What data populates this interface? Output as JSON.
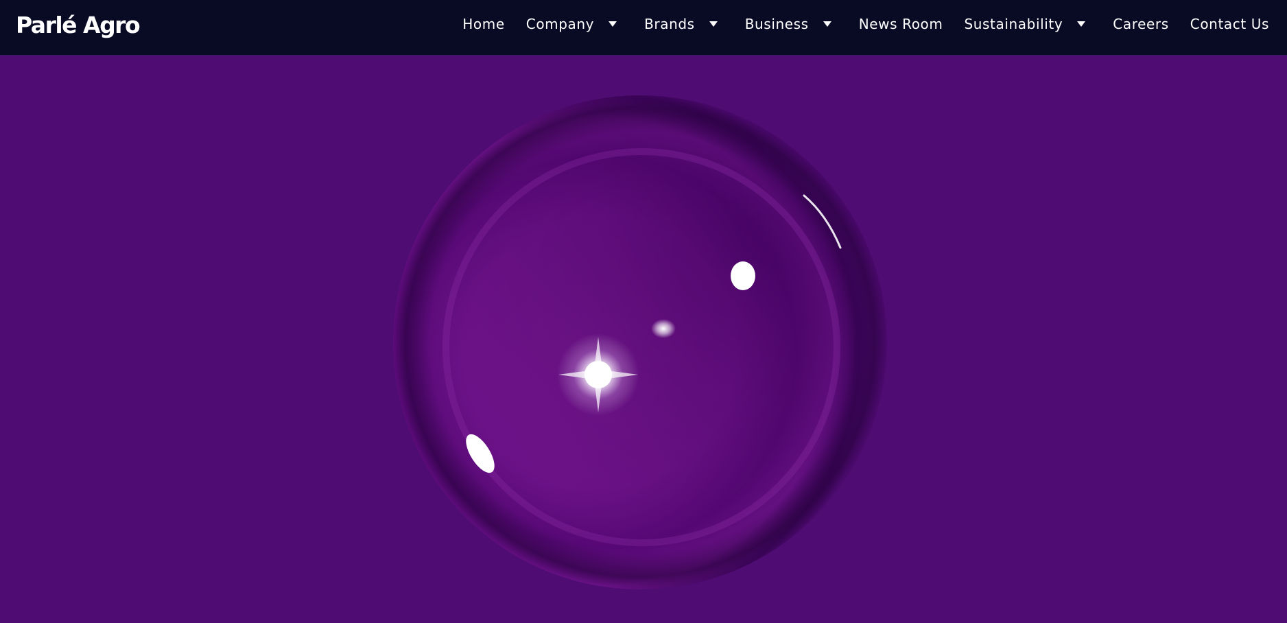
{
  "brand": {
    "logo_text": "Parlé Agro"
  },
  "nav": {
    "items": [
      {
        "label": "Home",
        "has_dropdown": false
      },
      {
        "label": "Company",
        "has_dropdown": true
      },
      {
        "label": "Brands",
        "has_dropdown": true
      },
      {
        "label": "Business",
        "has_dropdown": true
      },
      {
        "label": "News Room",
        "has_dropdown": false
      },
      {
        "label": "Sustainability",
        "has_dropdown": true
      },
      {
        "label": "Careers",
        "has_dropdown": false
      },
      {
        "label": "Contact Us",
        "has_dropdown": false
      }
    ],
    "dropdown_icon": "caret-down-icon"
  },
  "hero": {
    "visual": "purple-bubble",
    "background_color": "#4f0c73"
  },
  "colors": {
    "header_background": "#090b25",
    "bubble_core": "#74168f",
    "bubble_rim": "#2e0348",
    "text": "#ffffff"
  }
}
